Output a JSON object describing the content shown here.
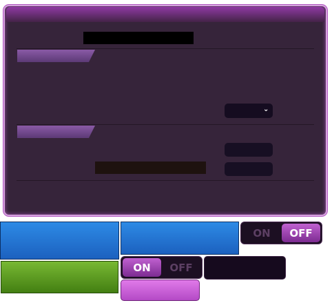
{
  "colors": {
    "panel_background": "#36243a",
    "panel_border": "#d7a3df",
    "accent_purple": "#8f3aa3",
    "blue_button": "#2d8ae5",
    "green_button": "#78b833",
    "pink_button": "#e07ae9"
  },
  "select": {
    "chevron_icon": "chevron-down-icon",
    "chevron_glyph": "⌄"
  },
  "toggle_top": {
    "on_label": "ON",
    "off_label": "OFF",
    "selected": "OFF"
  },
  "toggle_bottom": {
    "on_label": "ON",
    "off_label": "OFF",
    "selected": "ON"
  }
}
